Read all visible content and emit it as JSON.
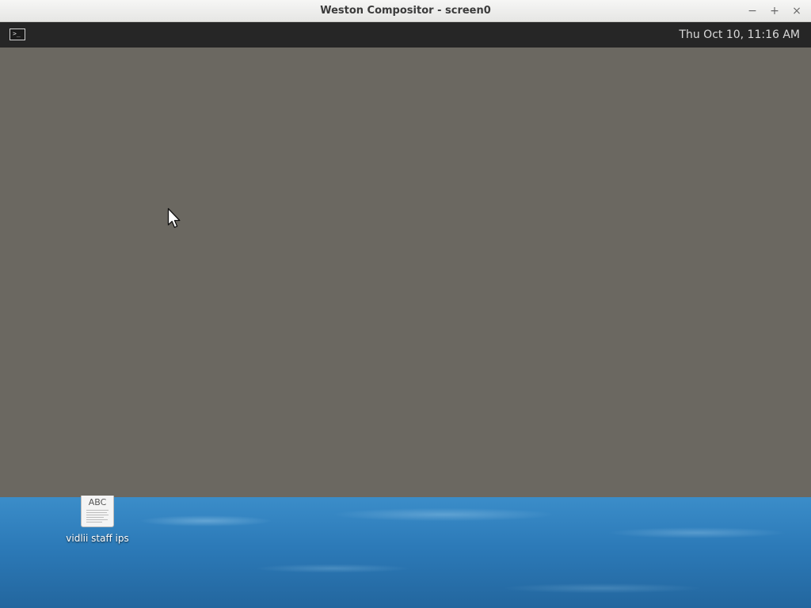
{
  "window": {
    "title": "Weston Compositor - screen0",
    "minimize_glyph": "−",
    "maximize_glyph": "+",
    "close_glyph": "×"
  },
  "panel": {
    "launcher_icon": "terminal-icon",
    "launcher_glyph": ">_",
    "clock": "Thu Oct 10, 11:16 AM"
  },
  "desktop": {
    "file": {
      "icon": "text-document-icon",
      "icon_text": "ABC",
      "label": "vidlii staff ips"
    }
  },
  "colors": {
    "panel_bg": "#262626",
    "surface_bg": "#6b6861",
    "wallpaper": "#2f7fbf"
  }
}
